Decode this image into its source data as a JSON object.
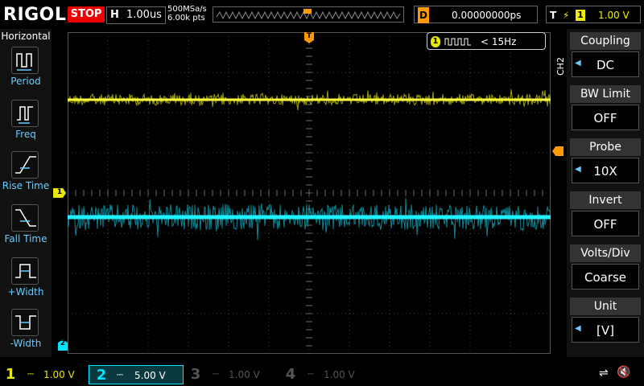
{
  "header": {
    "brand": "RIGOL",
    "run_state": "STOP",
    "timebase_label": "H",
    "timebase_value": "1.00us",
    "sample_rate": "500MSa/s",
    "memory_depth": "6.00k pts",
    "delay_label": "D",
    "delay_value": "0.00000000ps",
    "trigger_label": "T",
    "trigger_source": "1",
    "trigger_level": "1.00 V"
  },
  "left_menu": {
    "title": "Horizontal",
    "items": [
      {
        "label": "Period"
      },
      {
        "label": "Freq"
      },
      {
        "label": "Rise Time"
      },
      {
        "label": "Fall Time"
      },
      {
        "label": "+Width"
      },
      {
        "label": "-Width"
      }
    ]
  },
  "measurement": {
    "channel": "1",
    "value": "< 15Hz"
  },
  "right_menu": {
    "channel_tag": "CH2",
    "items": [
      {
        "title": "Coupling",
        "value": "DC"
      },
      {
        "title": "BW Limit",
        "value": "OFF"
      },
      {
        "title": "Probe",
        "value": "10X"
      },
      {
        "title": "Invert",
        "value": "OFF"
      },
      {
        "title": "Volts/Div",
        "value": "Coarse"
      },
      {
        "title": "Unit",
        "value": "[V]"
      }
    ]
  },
  "channels": [
    {
      "num": "1",
      "scale": "1.00 V",
      "color": "#e8e800"
    },
    {
      "num": "2",
      "scale": "5.00 V",
      "color": "#00e5ff"
    },
    {
      "num": "3",
      "scale": "1.00 V",
      "color": "#c000c0"
    },
    {
      "num": "4",
      "scale": "1.00 V",
      "color": "#3a6aff"
    }
  ],
  "markers": {
    "ch1": "1",
    "ch2": "2",
    "trigger_top": "T"
  },
  "icons": {
    "usb": "usb-icon",
    "mute": "speaker-mute-icon"
  }
}
